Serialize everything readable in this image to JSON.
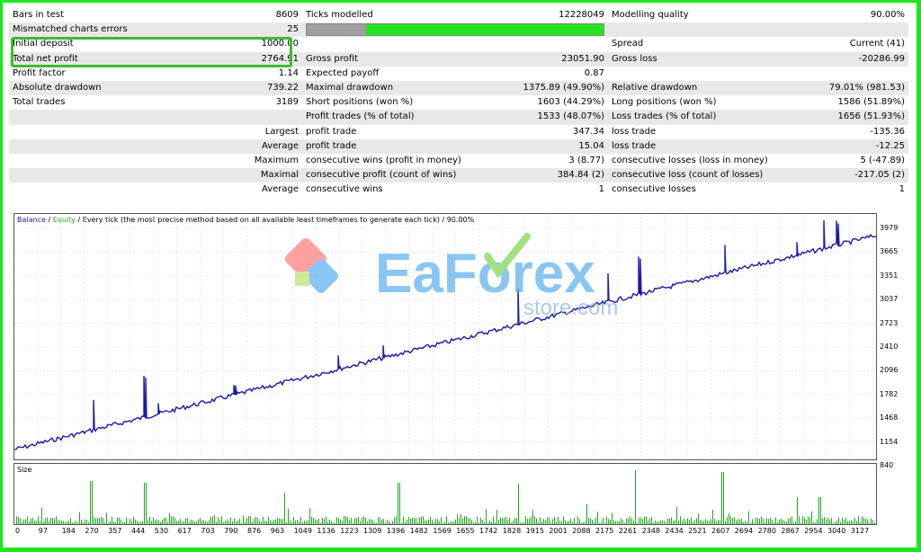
{
  "stats": {
    "rows": [
      [
        "Bars in test",
        "8609",
        "Ticks modelled",
        "12228049",
        "Modelling quality",
        "90.00%"
      ],
      [
        "Mismatched charts errors",
        "25",
        "",
        "",
        "",
        ""
      ],
      [
        "Initial deposit",
        "1000.00",
        "",
        "",
        "Spread",
        "Current (41)"
      ],
      [
        "Total net profit",
        "2764.91",
        "Gross profit",
        "23051.90",
        "Gross loss",
        "-20286.99"
      ],
      [
        "Profit factor",
        "1.14",
        "Expected payoff",
        "0.87",
        "",
        ""
      ],
      [
        "Absolute drawdown",
        "739.22",
        "Maximal drawdown",
        "1375.89 (49.90%)",
        "Relative drawdown",
        "79.01% (981.53)"
      ],
      [
        "Total trades",
        "3189",
        "Short positions (won %)",
        "1603 (44.29%)",
        "Long positions (won %)",
        "1586 (51.89%)"
      ],
      [
        "",
        "",
        "Profit trades (% of total)",
        "1533 (48.07%)",
        "Loss trades (% of total)",
        "1656 (51.93%)"
      ],
      [
        "",
        "Largest",
        "profit trade",
        "347.34",
        "loss trade",
        "-135.36"
      ],
      [
        "",
        "Average",
        "profit trade",
        "15.04",
        "loss trade",
        "-12.25"
      ],
      [
        "",
        "Maximum",
        "consecutive wins (profit in money)",
        "3 (8.77)",
        "consecutive losses (loss in money)",
        "5 (-47.89)"
      ],
      [
        "",
        "Maximal",
        "consecutive profit (count of wins)",
        "384.84 (2)",
        "consecutive loss (count of losses)",
        "-217.05 (2)"
      ],
      [
        "",
        "Average",
        "consecutive wins",
        "1",
        "consecutive losses",
        "1"
      ]
    ],
    "modelling_quality_bar": 0.2
  },
  "chart": {
    "legend": {
      "balance": "Balance",
      "sep1": " / ",
      "equity": "Equity",
      "rest": " / Every tick (the most precise method based on all available least timeframes to generate each tick) / 90.00%"
    },
    "y_ticks": [
      "3979",
      "3665",
      "3351",
      "3037",
      "2723",
      "2410",
      "2096",
      "1782",
      "1468",
      "1154",
      "840"
    ],
    "y_range": [
      840,
      3979
    ],
    "volume_label": "Size",
    "x_ticks": [
      "0",
      "97",
      "184",
      "270",
      "357",
      "444",
      "530",
      "617",
      "703",
      "790",
      "876",
      "963",
      "1049",
      "1136",
      "1223",
      "1309",
      "1396",
      "1482",
      "1569",
      "1655",
      "1742",
      "1828",
      "1915",
      "2001",
      "2088",
      "2175",
      "2261",
      "2348",
      "2434",
      "2521",
      "2607",
      "2694",
      "2780",
      "2867",
      "2954",
      "3040",
      "3127"
    ],
    "balance_color": "#1a1aa8",
    "volume_color": "#1aa81a"
  },
  "watermark": {
    "brand": "EaForex",
    "sub": "store.com"
  }
}
